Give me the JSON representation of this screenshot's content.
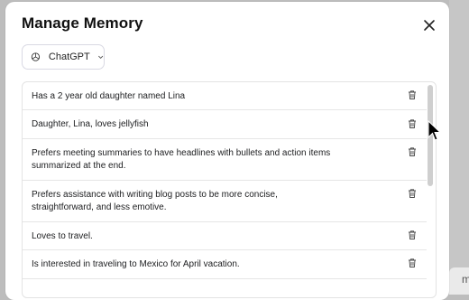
{
  "dialog": {
    "title": "Manage Memory",
    "model_selector": {
      "selected": "ChatGPT"
    }
  },
  "memories": [
    {
      "line1": "Has a 2 year old daughter named Lina",
      "line2": ""
    },
    {
      "line1": "Daughter, Lina, loves jellyfish",
      "line2": ""
    },
    {
      "line1": "Prefers meeting summaries to have headlines with bullets and action items",
      "line2": "summarized at the end."
    },
    {
      "line1": "Prefers assistance with writing blog posts to be more concise,",
      "line2": "straightforward, and less emotive."
    },
    {
      "line1": "Loves to travel.",
      "line2": ""
    },
    {
      "line1": "Is interested in traveling to Mexico for April vacation.",
      "line2": ""
    }
  ],
  "background_fragment": "ma",
  "icons": {
    "close": "close-icon",
    "model_logo": "openai-logo-icon",
    "dropdown": "chevron-down-icon",
    "delete": "trash-icon",
    "cursor": "mouse-pointer-icon"
  }
}
